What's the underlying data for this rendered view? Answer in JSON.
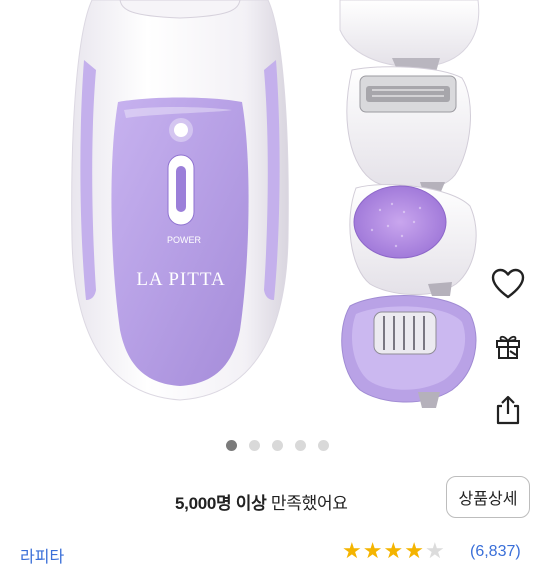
{
  "product": {
    "device_brand": "LA PITTA",
    "device_power_label": "POWER",
    "image_pager": {
      "count": 5,
      "active_index": 0
    }
  },
  "actions": {
    "like_icon": "heart-icon",
    "gift_icon": "gift-icon",
    "share_icon": "share-icon"
  },
  "satisfaction": {
    "count_bold": "5,000명 이상",
    "suffix": " 만족했어요",
    "detail_button": "상품상세"
  },
  "bottom": {
    "brand_link": "라피타",
    "rating": 4.5,
    "review_count": "(6,837)"
  },
  "colors": {
    "accent_purple": "#b9a2e6",
    "star": "#f4b400",
    "link": "#3a6fd8"
  }
}
